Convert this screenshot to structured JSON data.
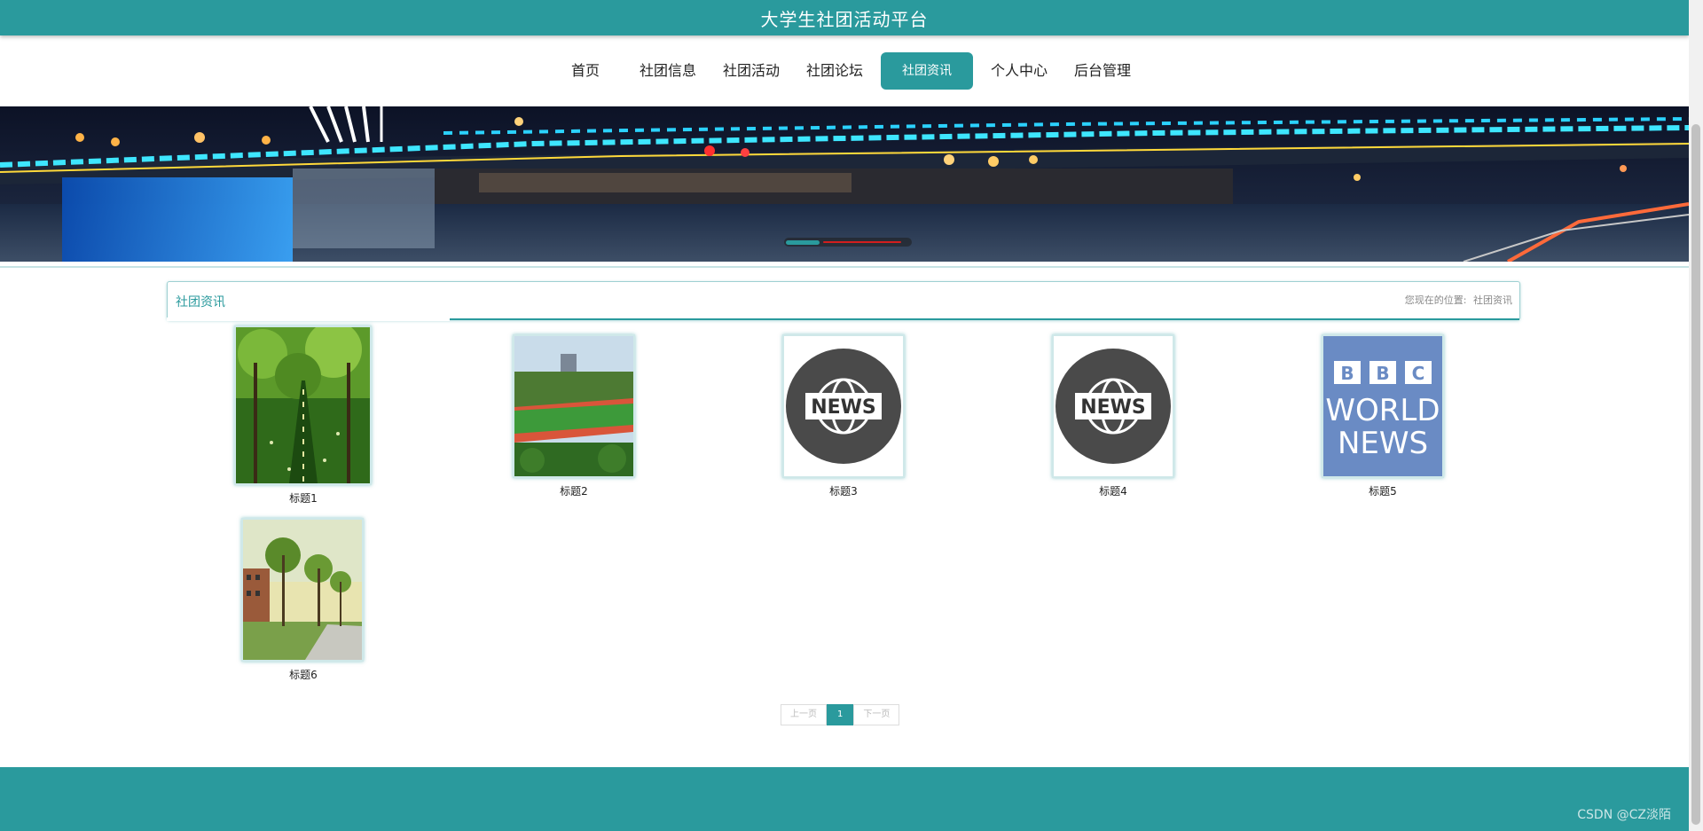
{
  "header": {
    "title": "大学生社团活动平台"
  },
  "nav": {
    "items": [
      {
        "label": "首页"
      },
      {
        "label": "社团信息"
      },
      {
        "label": "社团活动"
      },
      {
        "label": "社团论坛"
      },
      {
        "label": "社团资讯",
        "active": true
      },
      {
        "label": "个人中心"
      },
      {
        "label": "后台管理"
      }
    ]
  },
  "banner": {
    "slides": 2,
    "active_slide": 1
  },
  "section": {
    "title": "社团资讯",
    "breadcrumb_prefix": "您现在的位置:",
    "breadcrumb_current": "社团资讯"
  },
  "news": [
    {
      "caption": "标题1",
      "image": "tree-lined-path-photo"
    },
    {
      "caption": "标题2",
      "image": "sports-field-photo"
    },
    {
      "caption": "标题3",
      "image": "news-globe-icon"
    },
    {
      "caption": "标题4",
      "image": "news-globe-icon"
    },
    {
      "caption": "标题5",
      "image": "bbc-world-news-logo"
    },
    {
      "caption": "标题6",
      "image": "campus-trees-photo"
    }
  ],
  "pagination": {
    "prev": "上一页",
    "current": "1",
    "next": "下一页"
  },
  "watermark": "CSDN @CZ淡陌",
  "colors": {
    "primary": "#2a9a9d",
    "indicator_inactive": "#d21e1e"
  }
}
